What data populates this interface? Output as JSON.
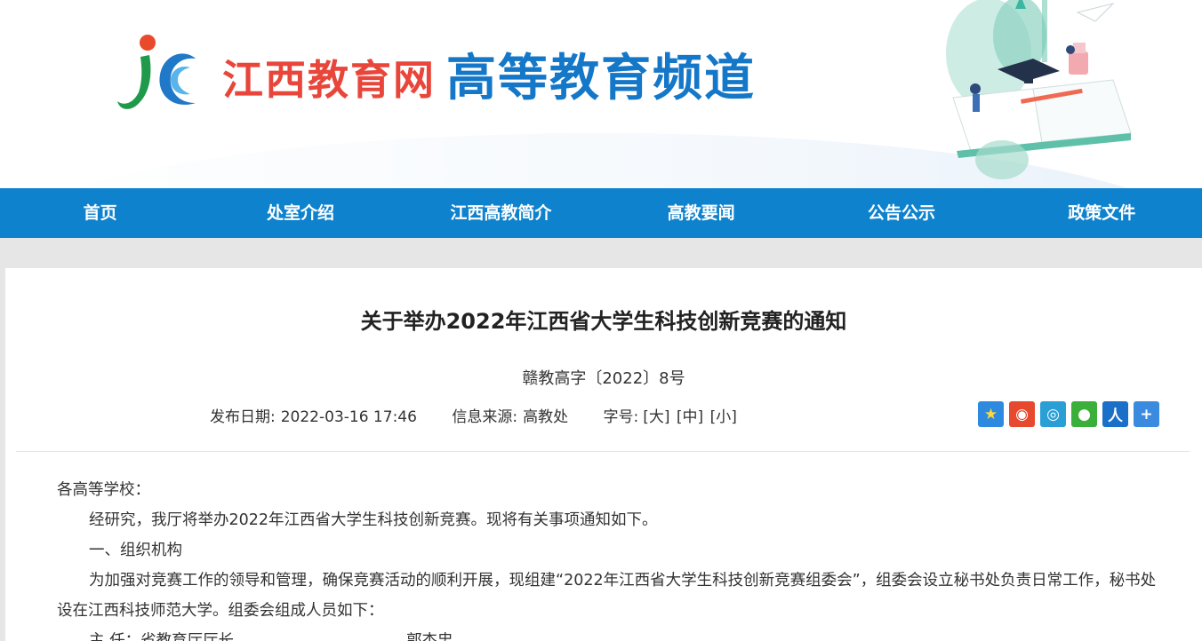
{
  "header": {
    "site_name": "江西教育网",
    "channel_name": "高等教育频道"
  },
  "nav": {
    "items": [
      {
        "label": "首页"
      },
      {
        "label": "处室介绍"
      },
      {
        "label": "江西高教简介"
      },
      {
        "label": "高教要闻"
      },
      {
        "label": "公告公示"
      },
      {
        "label": "政策文件"
      }
    ]
  },
  "article": {
    "title": "关于举办2022年江西省大学生科技创新竞赛的通知",
    "doc_number": "赣教高字〔2022〕8号",
    "meta": {
      "date_label": "发布日期:",
      "date_value": "2022-03-16 17:46",
      "source_label": "信息来源:",
      "source_value": "高教处",
      "fontsize_label": "字号:",
      "size_large": "[大]",
      "size_medium": "[中]",
      "size_small": "[小]"
    },
    "share_icons": [
      {
        "name": "favorite-star-icon",
        "color": "#2d8ae0"
      },
      {
        "name": "weibo-icon",
        "color": "#e6492d"
      },
      {
        "name": "tencent-weibo-icon",
        "color": "#2a9fd6"
      },
      {
        "name": "wechat-icon",
        "color": "#3aaf3a"
      },
      {
        "name": "renren-icon",
        "color": "#1a6fc9"
      },
      {
        "name": "more-share-icon",
        "color": "#3a8be0"
      }
    ],
    "paragraphs": {
      "p1": "各高等学校：",
      "p2": "经研究，我厅将举办2022年江西省大学生科技创新竞赛。现将有关事项通知如下。",
      "p3": "一、组织机构",
      "p4": "为加强对竞赛工作的领导和管理，确保竞赛活动的顺利开展，现组建“2022年江西省大学生科技创新竞赛组委会”，组委会设立秘书处负责日常工作，秘书处设在江西科技师范大学。组委会组成人员如下：",
      "p5_role": "主  任：省教育厅厅长",
      "p5_name": "郭杰忠"
    }
  },
  "colors": {
    "nav_bg": "#0e82cd",
    "site_name": "#e8463a",
    "channel_name": "#1477c8"
  }
}
